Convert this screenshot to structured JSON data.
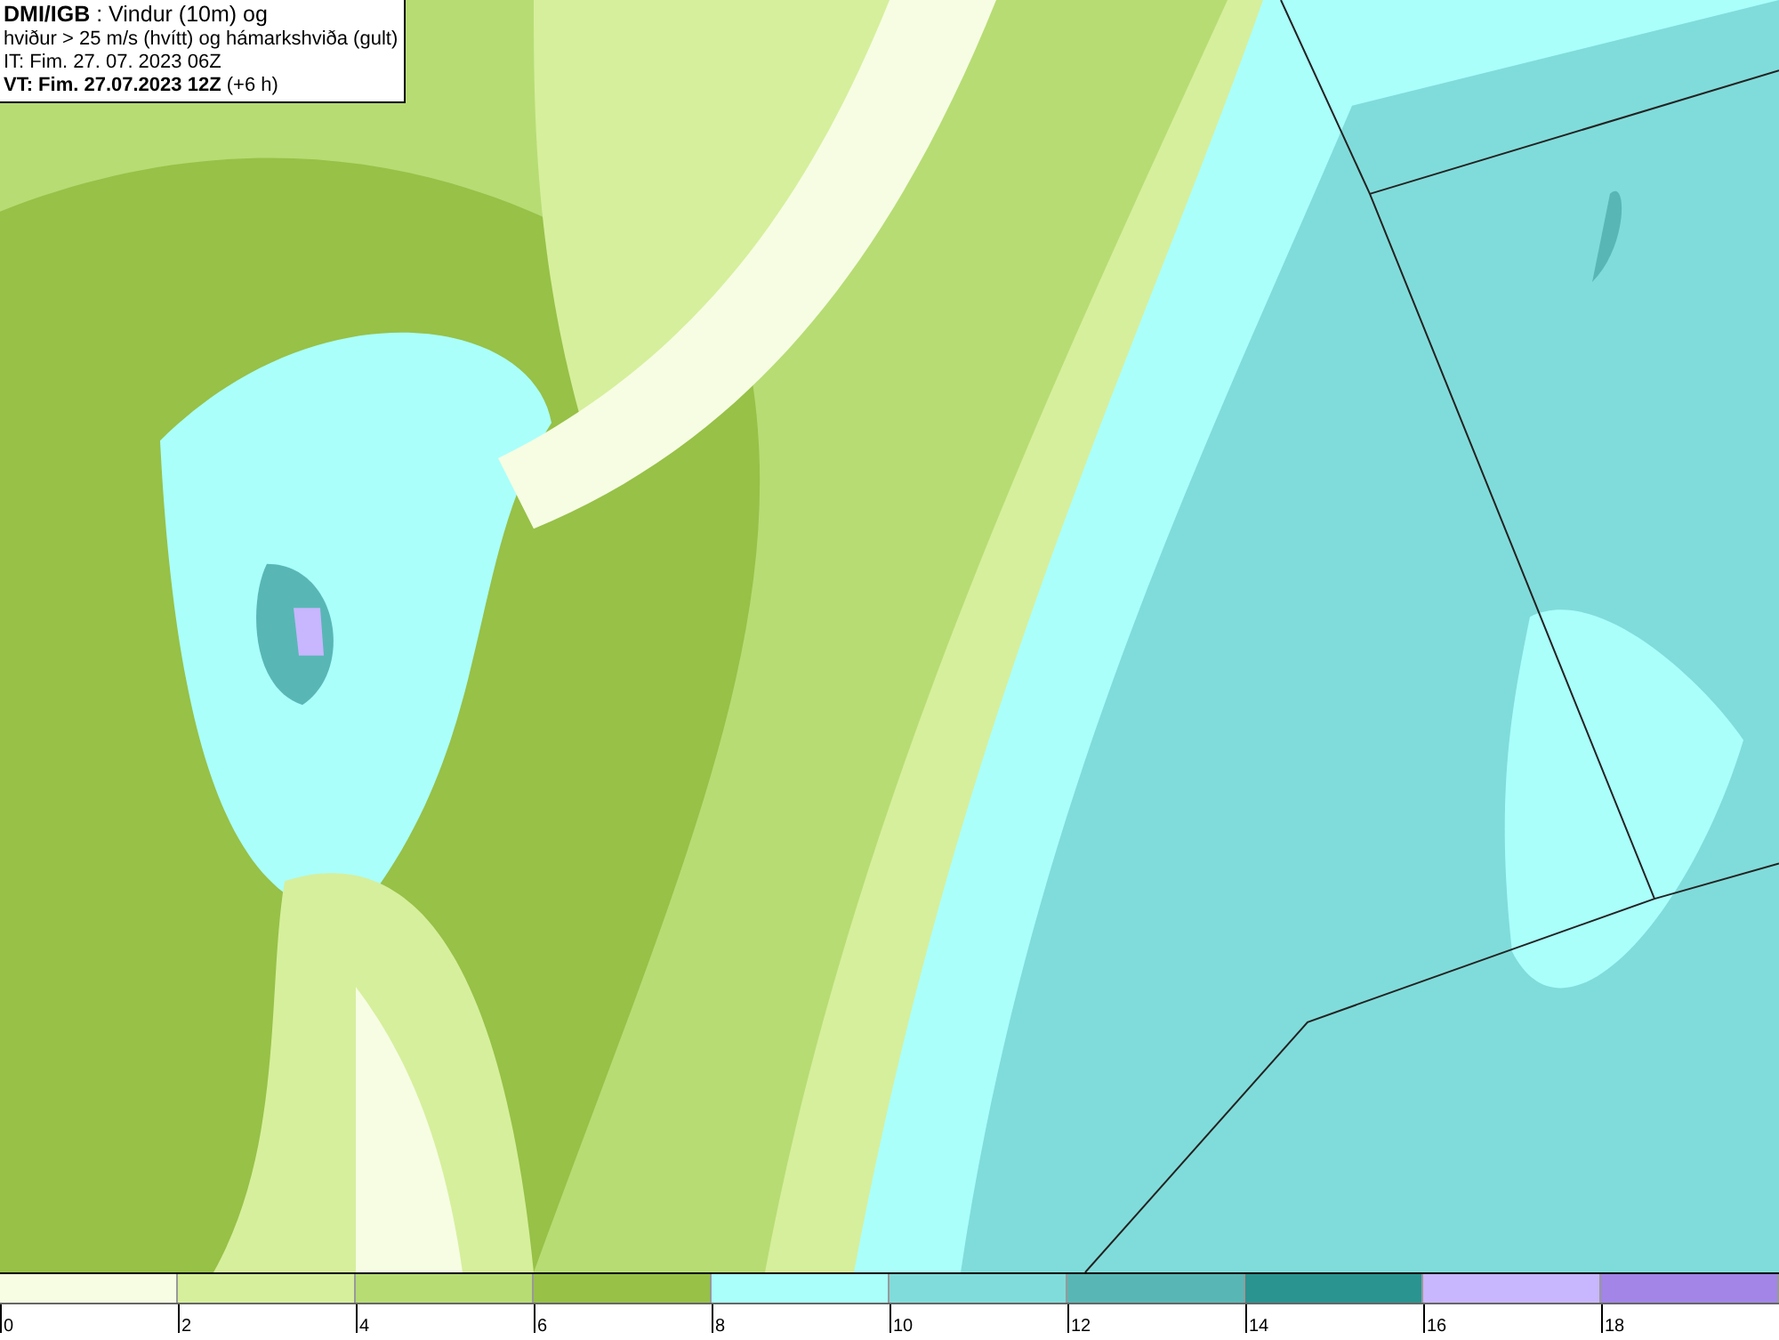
{
  "info_box": {
    "lines": [
      "**DMI/IGB** : Vindur (10m) og",
      "hviður > 25 m/s (hvítt) og hámarkshviða (gult)",
      "IT: Fim. 27. 07. 2023 06Z",
      "**VT: Fim. 27.07.2023 12Z** (+6 h)"
    ]
  },
  "colorbar": {
    "bins": [
      {
        "color": "#f6fde3",
        "label": "0"
      },
      {
        "color": "#d6ef9c",
        "label": "2"
      },
      {
        "color": "#b7dc74",
        "label": "4"
      },
      {
        "color": "#97c147",
        "label": "6"
      },
      {
        "color": "#aafffb",
        "label": "8"
      },
      {
        "color": "#80dcda",
        "label": "10"
      },
      {
        "color": "#58b7b5",
        "label": "12"
      },
      {
        "color": "#2a9490",
        "label": "14"
      },
      {
        "color": "#c8b6ff",
        "label": "16"
      },
      {
        "color": "#a285e6",
        "label": "18"
      }
    ]
  }
}
